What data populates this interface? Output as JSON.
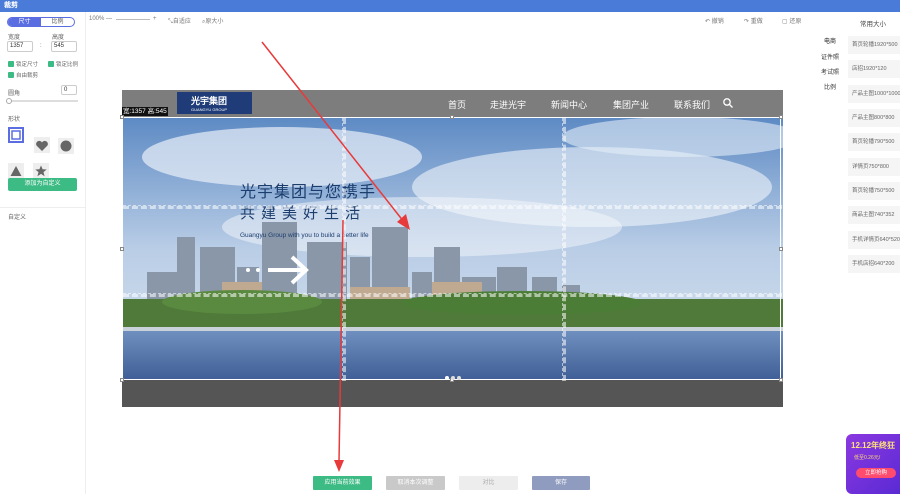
{
  "window": {
    "title": "裁剪"
  },
  "left_panel": {
    "mode_tabs": [
      "尺寸",
      "比例"
    ],
    "width_label": "宽度",
    "height_label": "高度",
    "width_value": "1357",
    "height_value": "545",
    "separator": ":",
    "lock_size": "锁定尺寸",
    "lock_ratio": "锁定比例",
    "free_crop": "自由裁剪",
    "radius_label": "圆角",
    "radius_value": "0",
    "shape_label": "形状",
    "add_custom": "添加为自定义",
    "custom_label": "自定义"
  },
  "toolbar": {
    "zoom": "100%",
    "minus": "—",
    "plus": "+",
    "fit": "自适应",
    "original": "原大小",
    "undo": "撤销",
    "redo": "重做",
    "restore": "还原"
  },
  "image": {
    "size_badge": "宽:1357 高:545",
    "logo_text": "光宇集团",
    "logo_sub": "GUANGYU GROUP",
    "nav": [
      "首页",
      "走进光宇",
      "新闻中心",
      "集团产业",
      "联系我们"
    ],
    "headline1": "光宇集团与您携手",
    "headline2": "共建美好生活",
    "subtitle": "Guangyu Group with you to build a better life",
    "slide_dots": 3
  },
  "right_panel": {
    "title": "常用大小",
    "tabs": [
      "电商",
      "证件照",
      "考试照",
      "比例"
    ],
    "presets": [
      "首页轮播1920*500",
      "店招1920*120",
      "产品主图1000*1000",
      "产品主图800*800",
      "首页轮播790*500",
      "详情页750*800",
      "首页轮播750*500",
      "商品主图740*352",
      "手机详情页640*520",
      "手机店招640*200"
    ]
  },
  "footer": {
    "apply": "应用当前效果",
    "cancel": "取消本次调整",
    "compare": "对比",
    "save": "保存"
  },
  "promo": {
    "line1": "12.12年终狂",
    "line2": "低至0.26元/",
    "button": "立即抢购"
  },
  "colors": {
    "accent": "#5b6ee1",
    "green": "#3dbb85",
    "titlebar": "#4a7bd8",
    "arrow": "#e83a3a"
  }
}
